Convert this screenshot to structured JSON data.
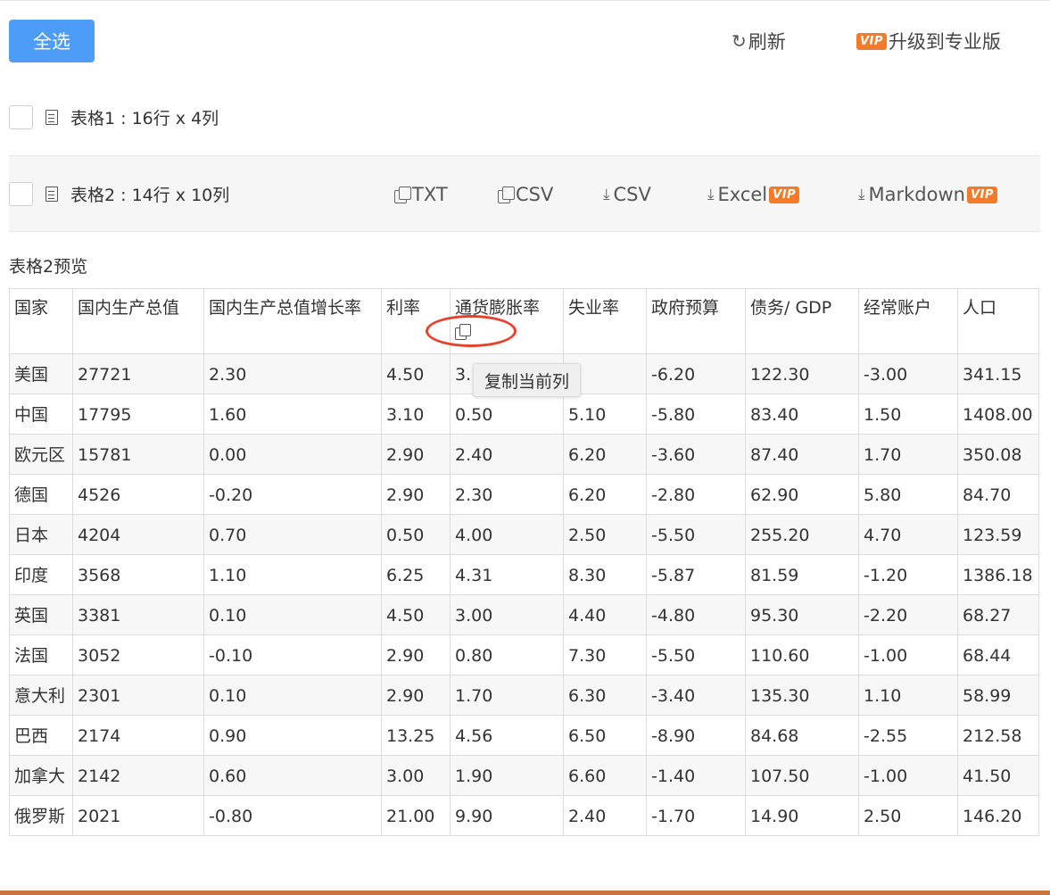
{
  "toolbar": {
    "select_all_label": "全选",
    "refresh_label": "刷新",
    "refresh_icon": "refresh-icon",
    "vip_badge": "VIP",
    "upgrade_label": "升级到专业版",
    "accent_color": "#4d9cf8",
    "vip_color": "#f47b2a"
  },
  "tables": [
    {
      "label": "表格1 : 16行 x 4列"
    },
    {
      "label": "表格2 : 14行 x 10列"
    }
  ],
  "actions": {
    "copy_txt": "TXT",
    "copy_csv": "CSV",
    "download_csv": "CSV",
    "download_excel": "Excel",
    "download_markdown": "Markdown",
    "vip_badge": "VIP"
  },
  "preview": {
    "title": "表格2预览",
    "headers": [
      "国家",
      "国内生产总值",
      "国内生产总值增长率",
      "利率",
      "通货膨胀率",
      "失业率",
      "政府预算",
      "债务/ GDP",
      "经常账户",
      "人口"
    ],
    "rows": [
      [
        "美国",
        "27721",
        "2.30",
        "4.50",
        "3.",
        "",
        "-6.20",
        "122.30",
        "-3.00",
        "341.15"
      ],
      [
        "中国",
        "17795",
        "1.60",
        "3.10",
        "0.50",
        "5.10",
        "-5.80",
        "83.40",
        "1.50",
        "1408.00"
      ],
      [
        "欧元区",
        "15781",
        "0.00",
        "2.90",
        "2.40",
        "6.20",
        "-3.60",
        "87.40",
        "1.70",
        "350.08"
      ],
      [
        "德国",
        "4526",
        "-0.20",
        "2.90",
        "2.30",
        "6.20",
        "-2.80",
        "62.90",
        "5.80",
        "84.70"
      ],
      [
        "日本",
        "4204",
        "0.70",
        "0.50",
        "4.00",
        "2.50",
        "-5.50",
        "255.20",
        "4.70",
        "123.59"
      ],
      [
        "印度",
        "3568",
        "1.10",
        "6.25",
        "4.31",
        "8.30",
        "-5.87",
        "81.59",
        "-1.20",
        "1386.18"
      ],
      [
        "英国",
        "3381",
        "0.10",
        "4.50",
        "3.00",
        "4.40",
        "-4.80",
        "95.30",
        "-2.20",
        "68.27"
      ],
      [
        "法国",
        "3052",
        "-0.10",
        "2.90",
        "0.80",
        "7.30",
        "-5.50",
        "110.60",
        "-1.00",
        "68.44"
      ],
      [
        "意大利",
        "2301",
        "0.10",
        "2.90",
        "1.70",
        "6.30",
        "-3.40",
        "135.30",
        "1.10",
        "58.99"
      ],
      [
        "巴西",
        "2174",
        "0.90",
        "13.25",
        "4.56",
        "6.50",
        "-8.90",
        "84.68",
        "-2.55",
        "212.58"
      ],
      [
        "加拿大",
        "2142",
        "0.60",
        "3.00",
        "1.90",
        "6.60",
        "-1.40",
        "107.50",
        "-1.00",
        "41.50"
      ],
      [
        "俄罗斯",
        "2021",
        "-0.80",
        "21.00",
        "9.90",
        "2.40",
        "-1.70",
        "14.90",
        "2.50",
        "146.20"
      ]
    ],
    "copy_column_icon": "copy-icon",
    "tooltip": "复制当前列"
  }
}
